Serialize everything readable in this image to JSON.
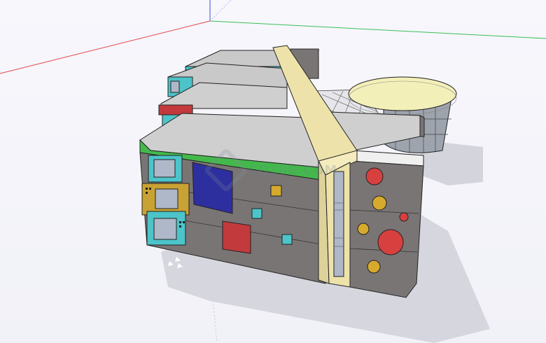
{
  "viewport": {
    "background": "#f4f4fa",
    "axis_colors": {
      "red": "#e0464b",
      "green": "#3bbf55",
      "blue": "#3a52d8"
    }
  },
  "watermark": {
    "text": "CO188.COM"
  },
  "model": {
    "palette": {
      "wall": "#7a7575",
      "wall_dark": "#5f5a5a",
      "roof": "#cfcfcf",
      "beam": "#ede3aa",
      "disk": "#f3efb8",
      "green_band": "#44b94b",
      "cyan": "#4cc4c9",
      "gold": "#c9a234",
      "blue_panel": "#2e2f9e",
      "red_panel": "#c23a3c",
      "red_circle": "#d84040",
      "gold_circle": "#d6aa2c",
      "glass": "#aeb8c8"
    }
  }
}
